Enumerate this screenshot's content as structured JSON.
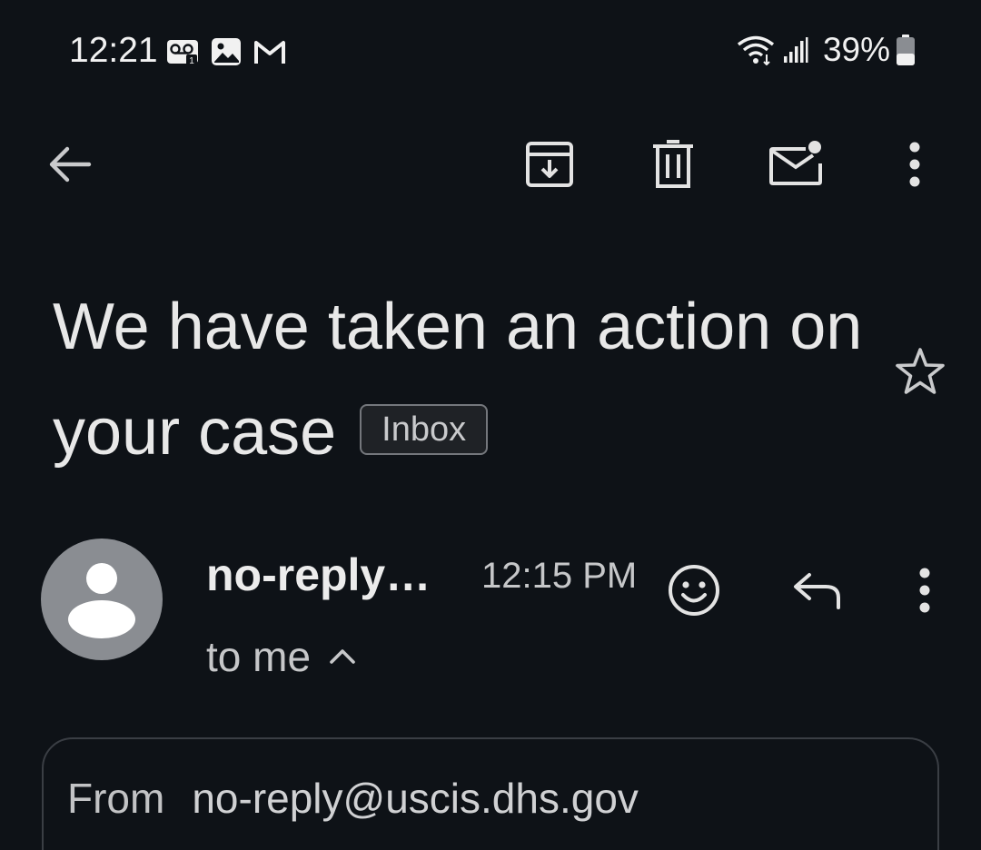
{
  "status_bar": {
    "time": "12:21",
    "left_icons": [
      "voicemail-icon",
      "image-icon",
      "gmail-icon"
    ],
    "battery_percent": "39%",
    "right_icons": [
      "wifi-icon",
      "signal-icon",
      "battery-icon"
    ]
  },
  "toolbar": {
    "buttons": [
      "back-arrow-icon",
      "archive-icon",
      "delete-icon",
      "mark-unread-icon",
      "more-options-icon"
    ]
  },
  "email": {
    "subject": "We have taken an action on your case",
    "label": "Inbox",
    "starred": false,
    "sender_display": "no-reply…",
    "time": "12:15 PM",
    "recipient": "to me",
    "details": {
      "from_label": "From",
      "from_value": "no-reply@uscis.dhs.gov"
    }
  },
  "colors": {
    "background": "#0e1217",
    "text_primary": "#e8e8e8",
    "text_secondary": "#c6c7c9",
    "avatar_bg": "#8a8d92"
  }
}
